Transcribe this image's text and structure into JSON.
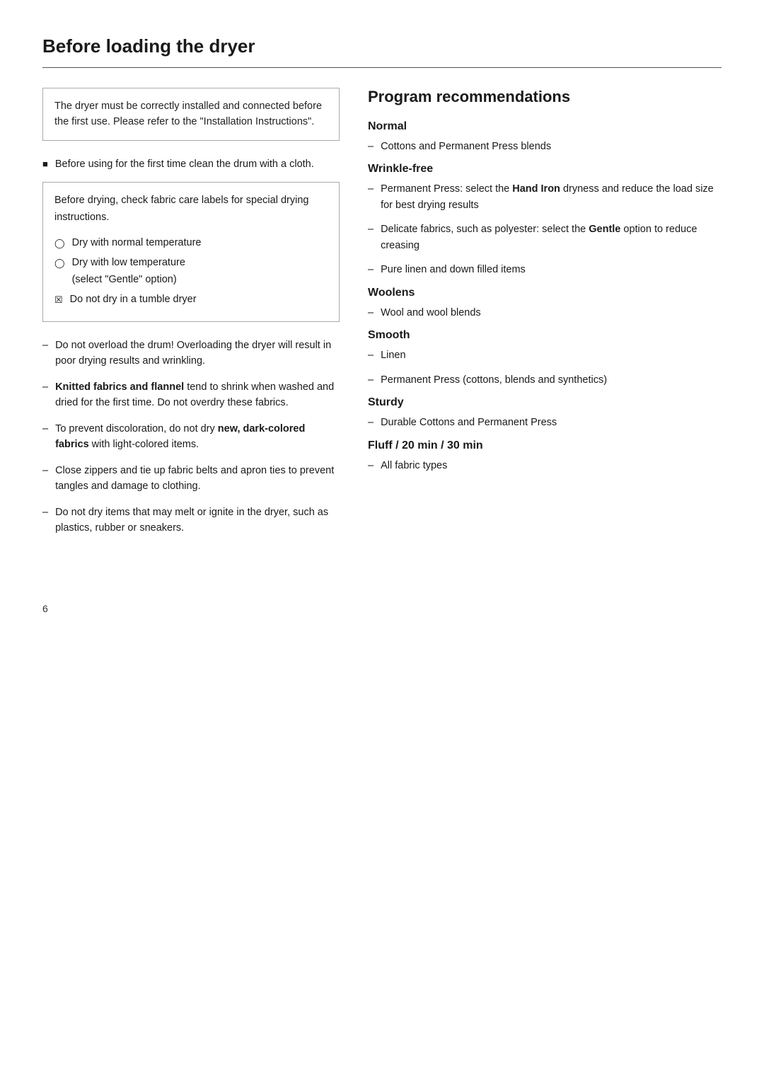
{
  "page": {
    "title": "Before loading the dryer",
    "page_number": "6"
  },
  "left": {
    "info_box_1": "The dryer must be correctly installed and connected before the first use. Please refer to the \"Installation Instructions\".",
    "bullet_1": "Before using for the first time clean the drum with a cloth.",
    "fabric_box": {
      "intro": "Before drying, check fabric care labels for special drying instructions.",
      "items": [
        {
          "icon": "circle-outline",
          "text": "Dry with normal temperature"
        },
        {
          "icon": "circle-outline",
          "text": "Dry with low temperature\n(select \"Gentle\" option)"
        },
        {
          "icon": "checkbox-x",
          "text": "Do not dry in a tumble dryer"
        }
      ]
    },
    "dash_items": [
      {
        "text_plain": "Do not overload the drum! Overloading the dryer will result in poor drying results and wrinkling.",
        "bold_part": null
      },
      {
        "text_before": "",
        "bold_part": "Knitted fabrics and flannel",
        "text_after": " tend to shrink when washed and dried for the first time. Do not overdry these fabrics."
      },
      {
        "text_before": "To prevent discoloration, do not dry ",
        "bold_part": "new, dark-colored fabrics",
        "text_after": " with light-colored items."
      },
      {
        "text_plain": "Close zippers and tie up fabric belts and apron ties to prevent tangles and damage to clothing.",
        "bold_part": null
      },
      {
        "text_plain": "Do not dry items that may melt or ignite in the dryer, such as plastics, rubber or sneakers.",
        "bold_part": null
      }
    ]
  },
  "right": {
    "title": "Program recommendations",
    "sections": [
      {
        "heading": "Normal",
        "items": [
          "Cottons and Permanent Press blends"
        ]
      },
      {
        "heading": "Wrinkle-free",
        "items": [
          {
            "text_before": "Permanent Press: select the ",
            "bold": "Hand Iron",
            "text_after": " dryness and reduce the load size for best drying results"
          },
          {
            "text_before": "Delicate fabrics, such as polyester: select the ",
            "bold": "Gentle",
            "text_after": " option to reduce creasing"
          },
          {
            "text_plain": "Pure linen and down filled items"
          }
        ]
      },
      {
        "heading": "Woolens",
        "items": [
          "Wool and wool blends"
        ]
      },
      {
        "heading": "Smooth",
        "items": [
          "Linen",
          "Permanent Press (cottons, blends and synthetics)"
        ]
      },
      {
        "heading": "Sturdy",
        "items": [
          "Durable Cottons and Permanent Press"
        ]
      },
      {
        "heading": "Fluff / 20 min / 30 min",
        "items": [
          "All fabric types"
        ]
      }
    ]
  }
}
